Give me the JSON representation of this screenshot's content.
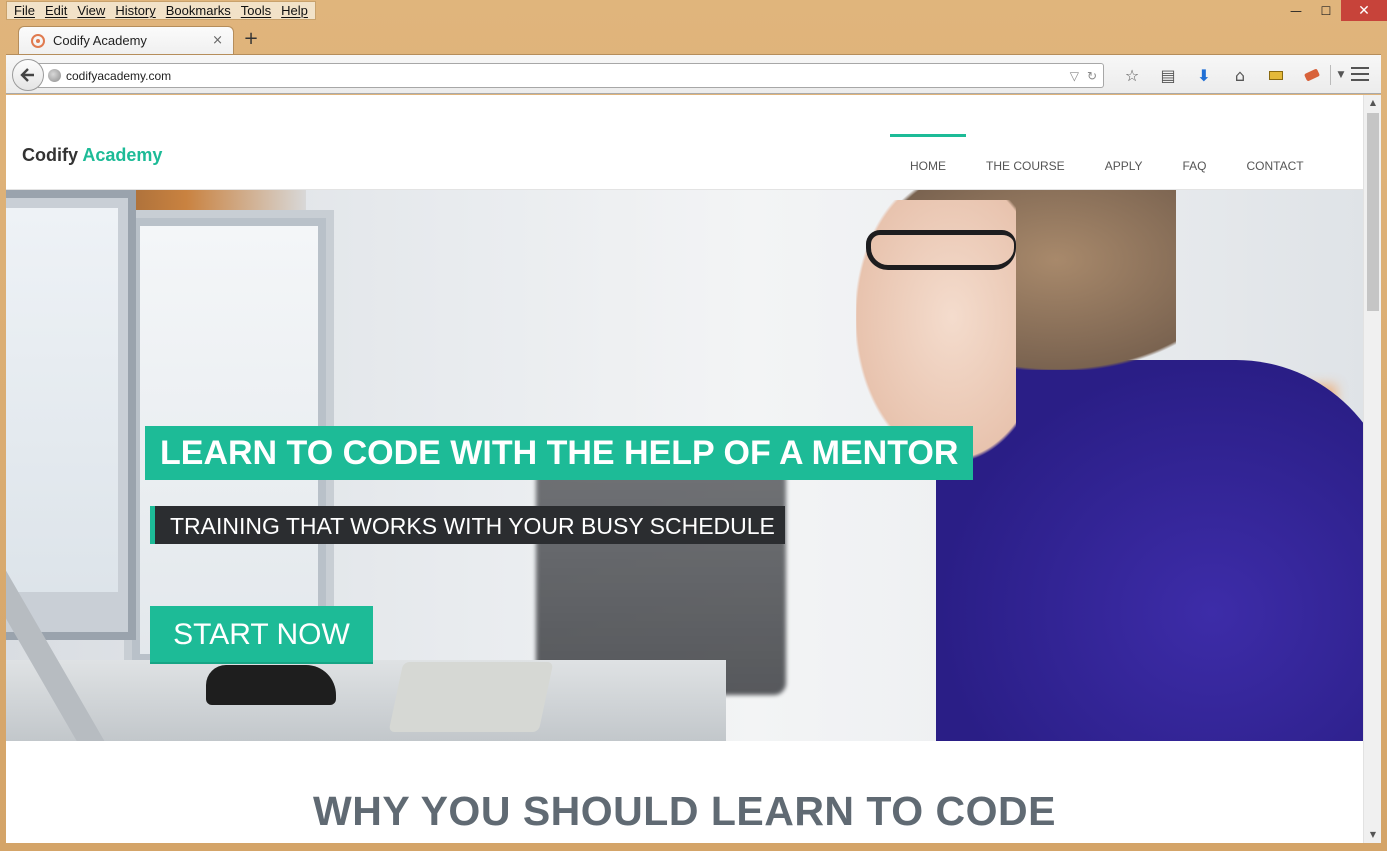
{
  "browser": {
    "menu": [
      "File",
      "Edit",
      "View",
      "History",
      "Bookmarks",
      "Tools",
      "Help"
    ],
    "window_controls": {
      "minimize": "—",
      "maximize": "☐",
      "close": "✕"
    },
    "tab": {
      "title": "Codify Academy",
      "close": "×"
    },
    "new_tab": "+",
    "url": "codifyacademy.com"
  },
  "site": {
    "logo": {
      "part1": "Codify",
      "part2": "Academy"
    },
    "nav": [
      "HOME",
      "THE COURSE",
      "APPLY",
      "FAQ",
      "CONTACT"
    ],
    "nav_active": "HOME",
    "hero": {
      "title": "LEARN TO CODE WITH THE HELP OF A MENTOR",
      "subtitle": "TRAINING THAT WORKS WITH YOUR BUSY SCHEDULE",
      "cta": "START NOW"
    },
    "section_heading": "WHY YOU SHOULD LEARN TO CODE"
  },
  "colors": {
    "accent": "#1dbb97",
    "dark": "#2b2d30",
    "heading": "#606a73"
  }
}
